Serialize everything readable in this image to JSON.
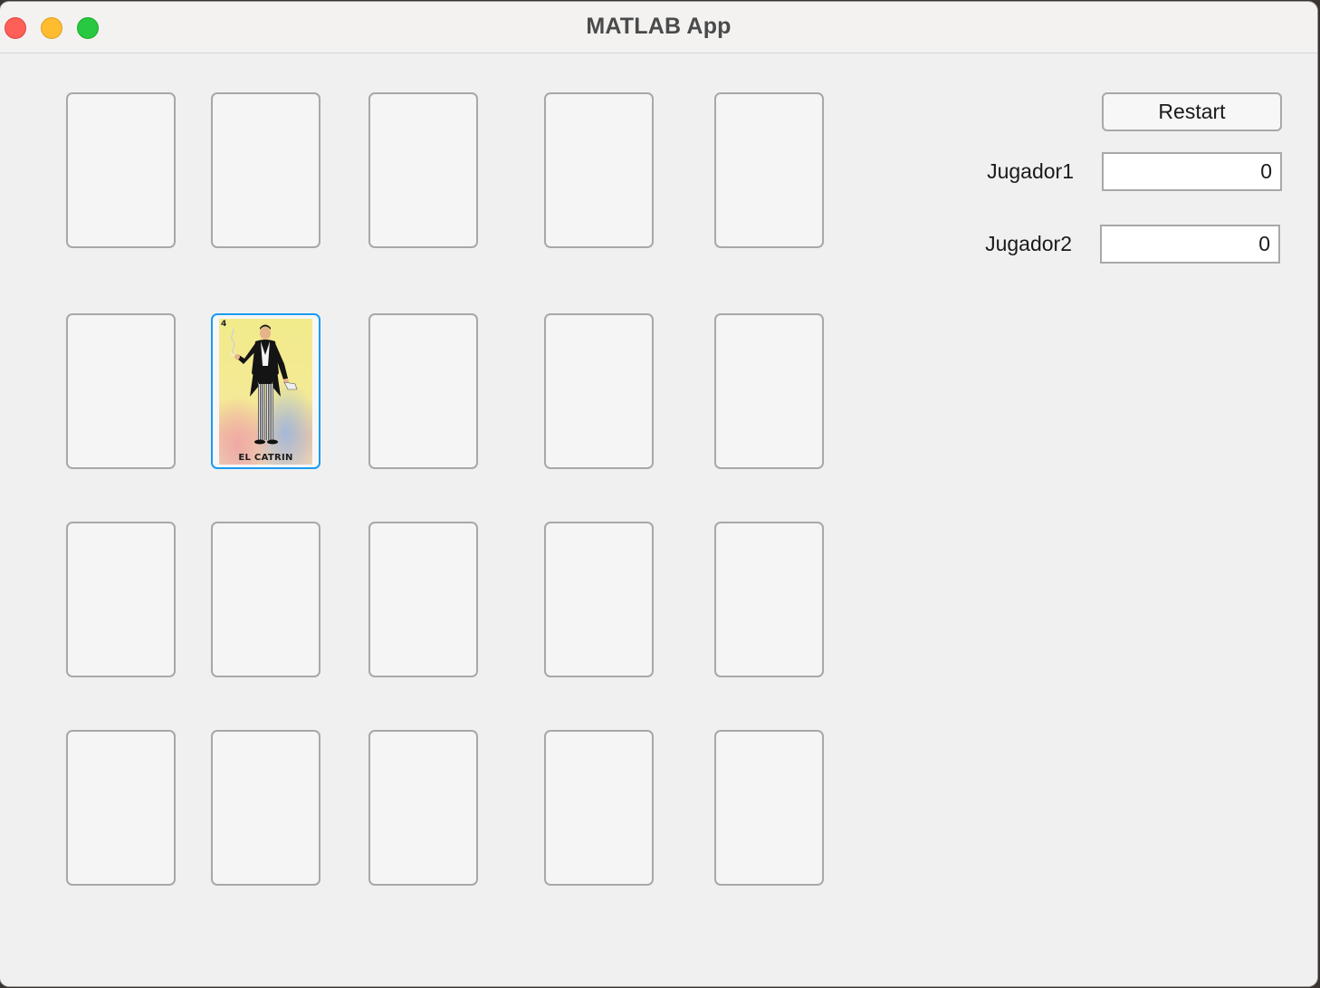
{
  "window": {
    "title": "MATLAB App"
  },
  "toolbar": {
    "restart_label": "Restart"
  },
  "scores": {
    "player1_label": "Jugador1",
    "player1_value": "0",
    "player2_label": "Jugador2",
    "player2_value": "0"
  },
  "board": {
    "rows": 4,
    "columns": 5,
    "revealed_card": {
      "row": 2,
      "column": 2,
      "caption": "EL CATRIN",
      "number": "4"
    }
  },
  "colors": {
    "selection_accent": "#1a9bf0",
    "card_border": "#a8a8a8",
    "background": "#f0f0f0"
  }
}
